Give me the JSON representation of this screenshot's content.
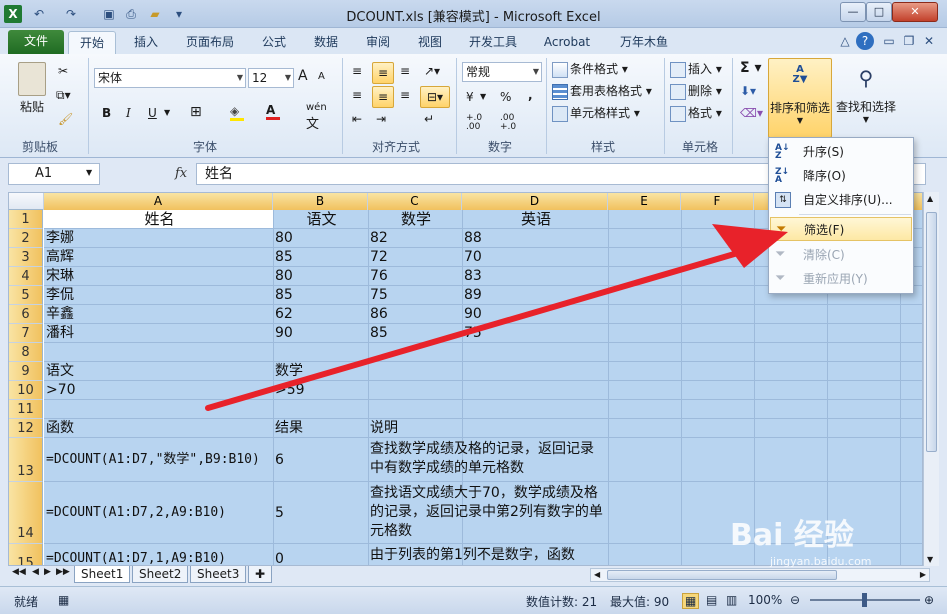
{
  "window": {
    "title": "DCOUNT.xls  [兼容模式] - Microsoft Excel"
  },
  "tabs": [
    "文件",
    "开始",
    "插入",
    "页面布局",
    "公式",
    "数据",
    "审阅",
    "视图",
    "开发工具",
    "Acrobat",
    "万年木鱼"
  ],
  "ribbon": {
    "clipboard": {
      "paste": "粘贴",
      "label": "剪贴板"
    },
    "font": {
      "name": "宋体",
      "size": "12",
      "bold": "B",
      "italic": "I",
      "underline": "U",
      "label": "字体",
      "grow": "A",
      "shrink": "A",
      "phonetic": "wén"
    },
    "alignment": {
      "label": "对齐方式"
    },
    "number": {
      "format": "常规",
      "percent": "%",
      "comma": ",",
      "label": "数字",
      "inc": "+.0 .00",
      "dec": ".00 +.0",
      "currency": "¥"
    },
    "styles": {
      "conditional": "条件格式",
      "table": "套用表格格式",
      "cell": "单元格样式",
      "label": "样式"
    },
    "cells": {
      "insert": "插入",
      "delete": "删除",
      "format": "格式",
      "label": "单元格"
    },
    "editing": {
      "sum": "Σ",
      "sort_filter": "排序和筛选",
      "find_select": "查找和选择"
    }
  },
  "formula_bar": {
    "name_box": "A1",
    "fx": "fx",
    "content": "姓名"
  },
  "columns": [
    "A",
    "B",
    "C",
    "D",
    "E",
    "F"
  ],
  "rows": [
    {
      "n": "1",
      "a": "姓名",
      "b": "语文",
      "c": "数学",
      "d": "英语"
    },
    {
      "n": "2",
      "a": "李娜",
      "b": "80",
      "c": "82",
      "d": "88"
    },
    {
      "n": "3",
      "a": "高辉",
      "b": "85",
      "c": "72",
      "d": "70"
    },
    {
      "n": "4",
      "a": "宋琳",
      "b": "80",
      "c": "76",
      "d": "83"
    },
    {
      "n": "5",
      "a": "李侃",
      "b": "85",
      "c": "75",
      "d": "89"
    },
    {
      "n": "6",
      "a": "辛鑫",
      "b": "62",
      "c": "86",
      "d": "90"
    },
    {
      "n": "7",
      "a": "潘科",
      "b": "90",
      "c": "85",
      "d": "75"
    },
    {
      "n": "8",
      "a": "",
      "b": "",
      "c": "",
      "d": ""
    },
    {
      "n": "9",
      "a": "语文",
      "b": "数学",
      "c": "",
      "d": ""
    },
    {
      "n": "10",
      "a": ">70",
      "b": ">59",
      "c": "",
      "d": ""
    },
    {
      "n": "11",
      "a": "",
      "b": "",
      "c": "",
      "d": ""
    },
    {
      "n": "12",
      "a": "函数",
      "b": "结果",
      "c": "说明",
      "d": ""
    },
    {
      "n": "13",
      "a": "=DCOUNT(A1:D7,\"数学\",B9:B10)",
      "b": "6",
      "c": "查找数学成绩及格的记录，返回记录中有数学成绩的单元格数",
      "d": ""
    },
    {
      "n": "14",
      "a": "=DCOUNT(A1:D7,2,A9:B10)",
      "b": "5",
      "c": "查找语文成绩大于70，数学成绩及格的记录，返回记录中第2列有数字的单元格数",
      "d": ""
    },
    {
      "n": "15",
      "a": "=DCOUNT(A1:D7,1,A9:B10)",
      "b": "0",
      "c": "由于列表的第1列不是数字，函数",
      "d": ""
    }
  ],
  "sheet_tabs": [
    "Sheet1",
    "Sheet2",
    "Sheet3"
  ],
  "status": {
    "mode": "就绪",
    "count": "数值计数: 21",
    "max": "最大值: 90",
    "zoom": "100%"
  },
  "sort_menu": {
    "asc": "升序(S)",
    "desc": "降序(O)",
    "custom": "自定义排序(U)...",
    "filter": "筛选(F)",
    "clear": "清除(C)",
    "reapply": "重新应用(Y)"
  },
  "watermark": {
    "main": "Bai 经验",
    "sub": "jingyan.baidu.com"
  },
  "colors": {
    "selection": "#b8d4f0",
    "arrow": "#e8222a",
    "file_tab": "#2a7a2c"
  }
}
